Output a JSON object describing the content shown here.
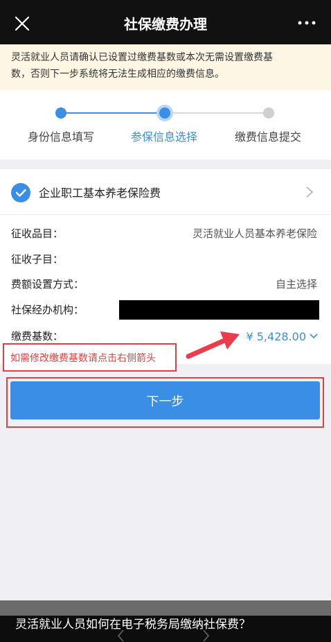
{
  "header": {
    "title": "社保缴费办理",
    "close_icon": "close-icon",
    "more_icon": "more-icon"
  },
  "notice": {
    "line1": "灵活就业人员请确认已设置过缴费基数或本次无需设置缴费基",
    "line2": "数，否则下一步系统将无法生成相应的缴费信息。"
  },
  "steps": [
    {
      "label": "身份信息填写",
      "state": "done"
    },
    {
      "label": "参保信息选择",
      "state": "current"
    },
    {
      "label": "缴费信息提交",
      "state": "todo"
    }
  ],
  "insurance": {
    "title": "企业职工基本养老保险费",
    "rows": [
      {
        "label": "征收品目：",
        "value": "灵活就业人员基本养老保险"
      },
      {
        "label": "征收子目：",
        "value": ""
      },
      {
        "label": "费额设置方式：",
        "value": "自主选择"
      },
      {
        "label": "社保经办机构：",
        "value": ""
      },
      {
        "label": "缴费基数：",
        "value": "¥ 5,428.00"
      }
    ]
  },
  "hint": "如需修改缴费基数请点击右侧箭头",
  "next_button": "下一步",
  "caption": "灵活就业人员如何在电子税务局缴纳社保费？",
  "colors": {
    "accent": "#3a8ee6",
    "warning_bg": "#fdf6e4",
    "annotation": "#e04040"
  }
}
